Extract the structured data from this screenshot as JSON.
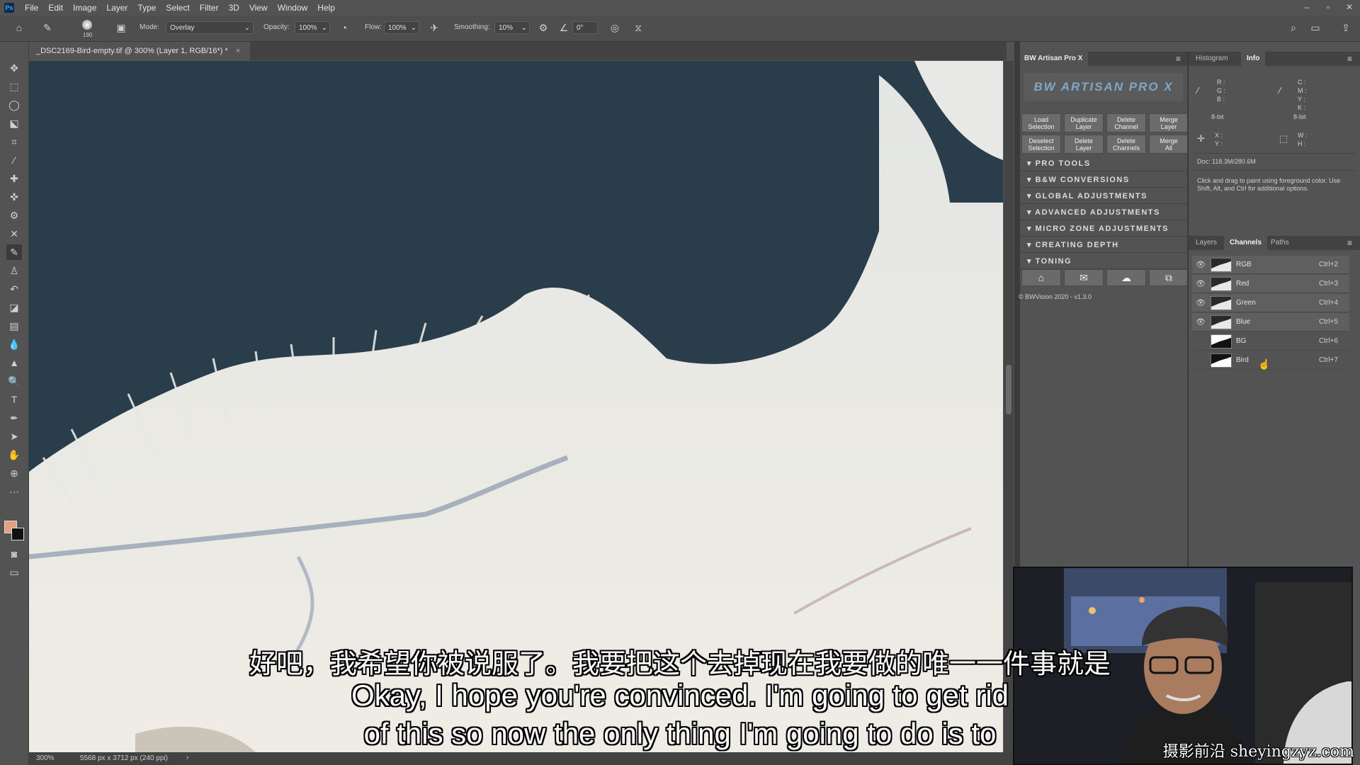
{
  "app": {
    "logo_text": "Ps"
  },
  "menu": [
    "File",
    "Edit",
    "Image",
    "Layer",
    "Type",
    "Select",
    "Filter",
    "3D",
    "View",
    "Window",
    "Help"
  ],
  "window_controls": [
    "–",
    "▫",
    "✕"
  ],
  "options": {
    "brush_size": "190",
    "mode_label": "Mode:",
    "mode_value": "Overlay",
    "opacity_label": "Opacity:",
    "opacity_value": "100%",
    "flow_label": "Flow:",
    "flow_value": "100%",
    "smoothing_label": "Smoothing:",
    "smoothing_value": "10%",
    "angle_value": "0°"
  },
  "document": {
    "tab_title": "_DSC2169-Bird-empty.tif @ 300% (Layer 1, RGB/16*) *",
    "tab_close": "×",
    "zoom": "300%",
    "dimensions": "5568 px x 3712 px (240 ppi)"
  },
  "bw_panel": {
    "tab": "BW Artisan Pro X",
    "logo": "BW ARTISAN PRO X",
    "buttons_row1": [
      "Load\nSelection",
      "Duplicate\nLayer",
      "Delete\nChannel",
      "Merge\nLayer"
    ],
    "buttons_row2": [
      "Deselect\nSelection",
      "Delete\nLayer",
      "Delete\nChannels",
      "Merge\nAll"
    ],
    "sections": [
      "PRO TOOLS",
      "B&W CONVERSIONS",
      "GLOBAL ADJUSTMENTS",
      "ADVANCED ADJUSTMENTS",
      "MICRO ZONE ADJUSTMENTS",
      "CREATING DEPTH",
      "TONING"
    ],
    "footer": "© BWVision 2020 - v1.3.0"
  },
  "info_panel": {
    "tabs": [
      "Histogram",
      "Info"
    ],
    "rgb_labels": [
      "R :",
      "G :",
      "B :"
    ],
    "cmyk_labels": [
      "C :",
      "M :",
      "Y :",
      "K :"
    ],
    "bit_left": "8-bit",
    "bit_right": "8-bit",
    "xy_labels": [
      "X :",
      "Y :"
    ],
    "wh_labels": [
      "W :",
      "H :"
    ],
    "doc": "Doc: 118.3M/280.6M",
    "hint": "Click and drag to paint using foreground color. Use Shift, Alt, and Ctrl for additional options."
  },
  "channels_panel": {
    "tabs": [
      "Layers",
      "Channels",
      "Paths"
    ],
    "rows": [
      {
        "name": "RGB",
        "shortcut": "Ctrl+2"
      },
      {
        "name": "Red",
        "shortcut": "Ctrl+3"
      },
      {
        "name": "Green",
        "shortcut": "Ctrl+4"
      },
      {
        "name": "Blue",
        "shortcut": "Ctrl+5"
      },
      {
        "name": "BG",
        "shortcut": "Ctrl+6"
      },
      {
        "name": "Bird",
        "shortcut": "Ctrl+7"
      }
    ]
  },
  "subtitles": {
    "cn": "好吧，我希望你被说服了。我要把这个去掉现在我要做的唯一一件事就是",
    "en1": "Okay, I hope you're convinced. I'm going to get rid",
    "en2": "of this so now the only thing I'm going to do is to"
  },
  "watermark": "摄影前沿 sheyingzyz.com",
  "colors": {
    "foreground": "#e3a17f",
    "background": "#111111",
    "accent": "#31a8ff"
  }
}
